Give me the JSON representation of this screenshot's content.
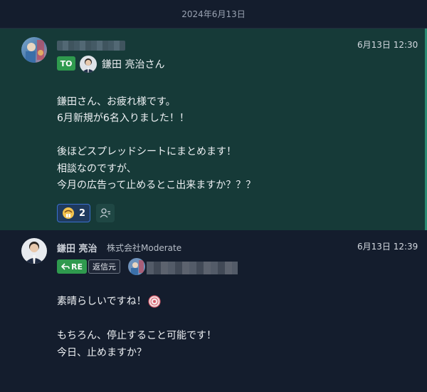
{
  "date_separator": "2024年6月13日",
  "messages": [
    {
      "time": "6月13日 12:30",
      "to_tag": "TO",
      "to_name": "鎌田 亮治さん",
      "body_lines": [
        "鎌田さん、お疲れ様です。",
        "6月新規が6名入りました！！",
        "",
        "後ほどスプレッドシートにまとめます！",
        "相談なのですが、",
        "今月の広告って止めるとこ出来ますか？？？"
      ],
      "reaction_count": "2"
    },
    {
      "sender_name": "鎌田 亮治",
      "sender_org": "株式会社Moderate",
      "time": "6月13日 12:39",
      "re_tag": "RE",
      "source_button": "返信元",
      "body_lines": [
        "素晴らしいですね！",
        "",
        "もちろん、停止すること可能です！",
        "今日、止めますか？"
      ]
    }
  ],
  "colors": {
    "background": "#141d2d",
    "highlight_message": "#163a38",
    "tag_green": "#2f9a4e",
    "reaction_border": "#3a6fd0"
  }
}
